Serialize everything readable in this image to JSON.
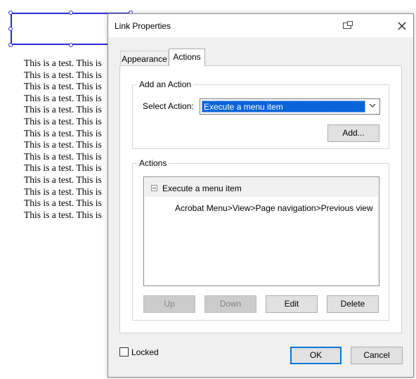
{
  "document": {
    "lines": [
      "This is a test. This is",
      "This is a test. This is",
      "This is a test. This is",
      "This is a test. This is",
      "This is a test. This is",
      "This is a test. This is",
      "This is a test. This is",
      "This is a test. This is",
      "This is a test. This is",
      "This is a test. This is",
      "This is a test. This is",
      "This is a test. This is",
      "This is a test. This is",
      "This is a test. This is"
    ]
  },
  "dialog": {
    "title": "Link Properties",
    "tabs": [
      "Appearance",
      "Actions"
    ],
    "active_tab": "Actions",
    "add_action": {
      "group_label": "Add an Action",
      "select_label": "Select Action:",
      "selected_value": "Execute a menu item",
      "add_button": "Add..."
    },
    "actions": {
      "group_label": "Actions",
      "tree_parent": "Execute a menu item",
      "tree_child": "Acrobat Menu>View>Page navigation>Previous view",
      "buttons": {
        "up": "Up",
        "down": "Down",
        "edit": "Edit",
        "delete": "Delete"
      }
    },
    "locked_label": "Locked",
    "locked_checked": false,
    "ok_label": "OK",
    "cancel_label": "Cancel"
  },
  "colors": {
    "selection_blue": "#2a2ad6",
    "select_highlight": "#0a64d8",
    "primary_border": "#0078d7"
  }
}
